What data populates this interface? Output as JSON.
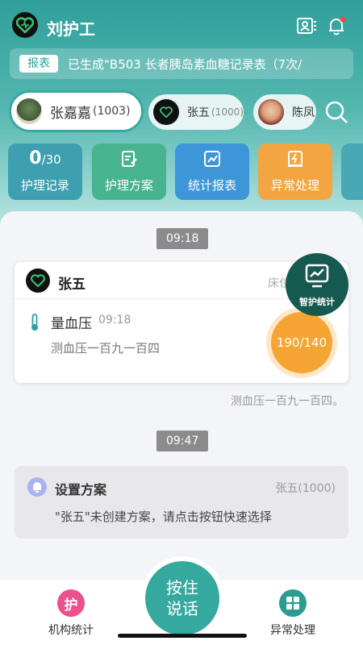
{
  "header": {
    "title": "刘护工"
  },
  "notice": {
    "tag": "报表",
    "text": "已生成\"B503 长者胰岛素血糖记录表（7次/"
  },
  "patients": [
    {
      "name": "张嘉嘉",
      "id": "(1003)",
      "active": true
    },
    {
      "name": "张五",
      "id": "(1000)",
      "active": false
    },
    {
      "name": "陈凤贞",
      "id": "",
      "active": false
    }
  ],
  "features": {
    "records": {
      "count": "0",
      "total": "/30",
      "label": "护理记录",
      "color": "#3d9fb0"
    },
    "plans": {
      "label": "护理方案",
      "color": "#47b38f"
    },
    "reports": {
      "label": "统计报表",
      "color": "#3d96d8"
    },
    "abnormal": {
      "label": "异常处理",
      "color": "#f2a541"
    }
  },
  "timeline": {
    "time1": "09:18",
    "record": {
      "name": "张五",
      "bed": "床位",
      "title": "量血压",
      "time": "09:18",
      "desc": "测血压一百九一百四",
      "value": "190/140"
    },
    "voice_note": "测血压一百九一百四。",
    "time2": "09:47",
    "plan": {
      "title": "设置方案",
      "who": "张五(1000)",
      "desc": "\"张五\"未创建方案，请点击按钮快速选择"
    }
  },
  "fab": {
    "label": "智护统计"
  },
  "bottom": {
    "left": {
      "icon_text": "护",
      "label": "机构统计"
    },
    "voice": {
      "line1": "按住",
      "line2": "说话"
    },
    "right": {
      "label": "异常处理"
    }
  }
}
